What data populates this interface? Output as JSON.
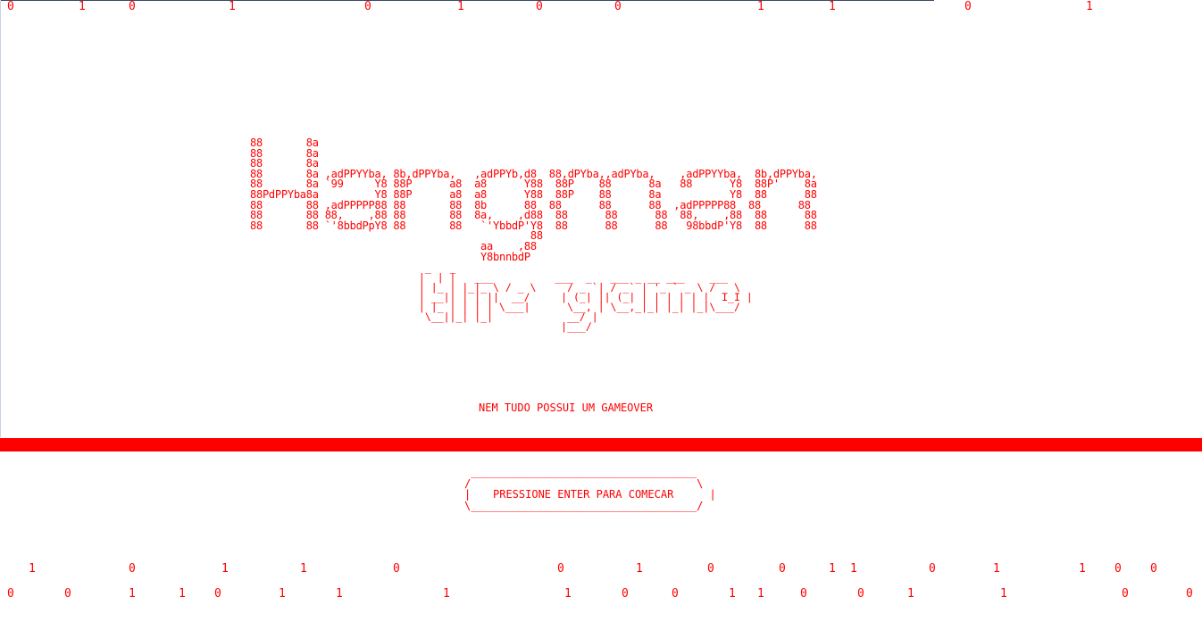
{
  "colors": {
    "text": "#ff0000",
    "background": "#ffffff",
    "bar": "#ff0000"
  },
  "binary_rain": {
    "top": [
      "0",
      "1",
      "0",
      "1",
      "0",
      "1",
      "0",
      "0",
      "1",
      "1",
      "0",
      "1"
    ],
    "bottom_1": [
      "1",
      "0",
      "1",
      "1",
      "0",
      "0",
      "1",
      "0",
      "0",
      "1",
      "1",
      "0",
      "1",
      "1",
      "0",
      "0"
    ],
    "bottom_2": [
      "0",
      "0",
      "1",
      "1",
      "0",
      "1",
      "1",
      "1",
      "1",
      "0",
      "0",
      "1",
      "1",
      "0",
      "0",
      "1",
      "1",
      "0",
      "0"
    ]
  },
  "title_art": {
    "logo": "88       8a\n88       8a\n88       8a\n88       8a ,adPPYYba, 8b,dPPYba,   ,adPPYb,d8  88,dPYba,,adPYba,    ,adPPYYba,  8b,dPPYba,\n88       8a `99     Y8 88P      a8  a8      Y88  88P    88      8a   88      Y8  88P'    8a\n88PdPPYba8a         Y8 88P      a8  a8      Y88  88P    88      8a           Y8  88      88\n88       88 ,adPPPPP88 88       88  8b      88  88      88      88  ,adPPPPP88  88      88\n88       88 88,    ,88 88       88  8a,    ,d88  88      88      88  88,    ,88  88      88\n88       88 `'8bbdPpY8 88       88   `'YbbdP'Y8  88      88      88   98bbdP'Y8  88      88\n                                             88\n                                     aa    ,88\n                                     Y8bnnbdP",
    "game": "  _   _\n |  | |   ___          ___  _   ___ _ __ ___    ___\n | |_ | |_|_ \\ / _ \\     / _ `| / _` | '_ ` _ \\ / _ \\\n | __|| | | ||  __/     | (_| || (_| | | | | | |  I_I |\n | |_ | | | | \\___|      \\__, | \\__,_|_| |_| |_|\\___/\n  \\__||_| |_|            __/ |\n                        |___/"
  },
  "subtitle": "NEM TUDO POSSUI UM GAMEOVER",
  "start_prompt": {
    "frame": " ___________________________________\n/                                   \\\n|                                     |\n\\___________________________________/",
    "label": "PRESSIONE ENTER PARA COMECAR"
  }
}
